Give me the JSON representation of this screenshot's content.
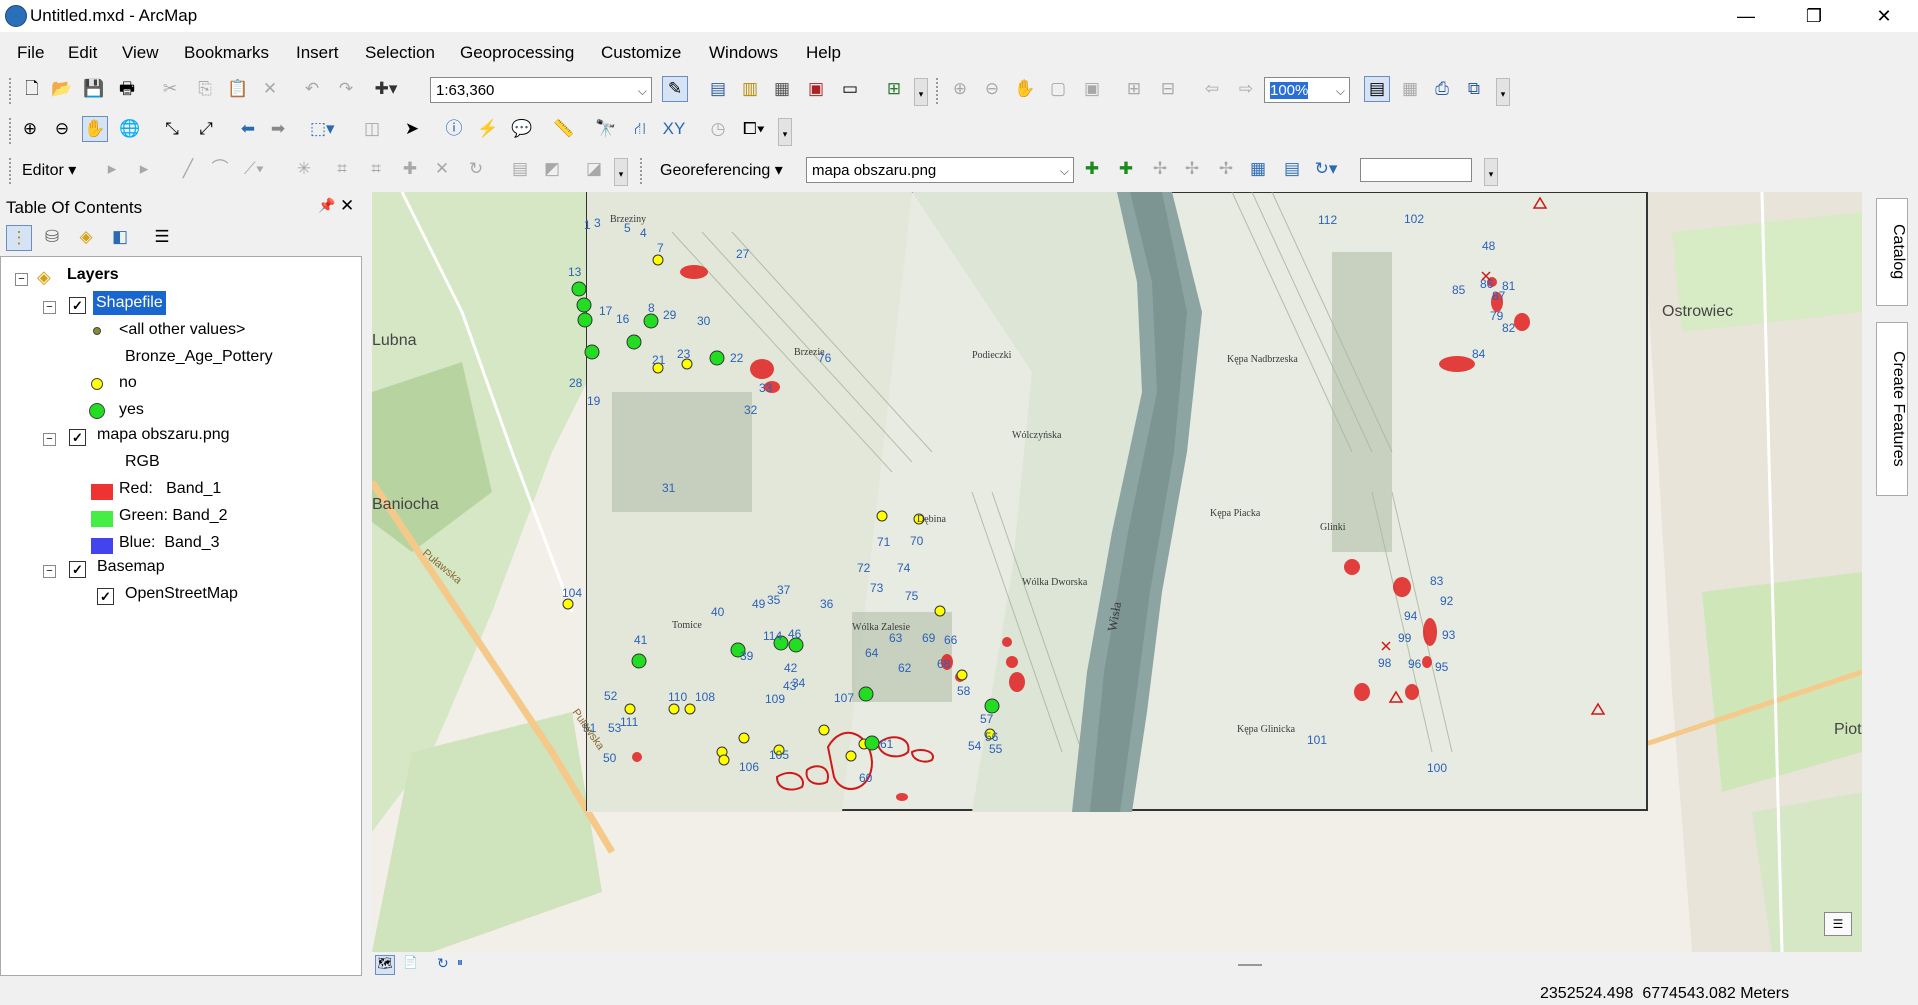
{
  "window": {
    "title": "Untitled.mxd - ArcMap",
    "minimize": "—",
    "maximize": "❐",
    "close": "✕"
  },
  "menu": [
    "File",
    "Edit",
    "View",
    "Bookmarks",
    "Insert",
    "Selection",
    "Geoprocessing",
    "Customize",
    "Windows",
    "Help"
  ],
  "standard_toolbar": {
    "scale_value": "1:63,360",
    "zoom_percent": "100%"
  },
  "editor_toolbar": {
    "editor_label": "Editor ▾"
  },
  "georef_toolbar": {
    "label": "Georeferencing ▾",
    "layer_value": "mapa obszaru.png",
    "input_value": ""
  },
  "toc": {
    "title": "Table Of Contents",
    "pin": "ᵖ",
    "close": "✕",
    "layers_label": "Layers",
    "shapefile": {
      "name": "Shapefile",
      "other": "<all other values>",
      "field": "Bronze_Age_Pottery",
      "no": "no",
      "yes": "yes"
    },
    "raster": {
      "name": "mapa obszaru.png",
      "rgb": "RGB",
      "red": "Red:   Band_1",
      "green": "Green: Band_2",
      "blue": "Blue:  Band_3"
    },
    "basemap": {
      "name": "Basemap",
      "osm": "OpenStreetMap"
    }
  },
  "map": {
    "basemap_labels": [
      "Lubna",
      "Baniocha",
      "Ostrowiec",
      "Piotr",
      "Puławska",
      "Puławska"
    ],
    "hist_labels": [
      "Brzeziny",
      "Brzezie",
      "Wólka Zalesie",
      "Wólka Dworska",
      "Kępa Nadbrzeska",
      "Kępa Glinicka",
      "Tomice",
      "Podieczki",
      "Wólczyńska",
      "Wisła",
      "Kępa Piacka",
      "Glinki",
      "Dębina"
    ],
    "site_numbers": [
      "13",
      "17",
      "16",
      "8",
      "29",
      "30",
      "21",
      "22",
      "23",
      "76",
      "33",
      "32",
      "19",
      "28",
      "27",
      "7",
      "4",
      "5",
      "1",
      "3",
      "31",
      "71",
      "74",
      "73",
      "72",
      "75",
      "70",
      "69",
      "63",
      "66",
      "62",
      "68",
      "58",
      "57",
      "56",
      "55",
      "54",
      "61",
      "64",
      "60",
      "42",
      "43",
      "52",
      "53",
      "51",
      "50",
      "110",
      "111",
      "108",
      "109",
      "105",
      "106",
      "107",
      "104",
      "114",
      "39",
      "40",
      "41",
      "46",
      "49",
      "35",
      "36",
      "37",
      "34",
      "48",
      "81",
      "86",
      "87",
      "82",
      "84",
      "85",
      "79",
      "83",
      "92",
      "93",
      "94",
      "95",
      "96",
      "98",
      "99",
      "100",
      "101",
      "112",
      "102",
      "103"
    ],
    "colors": {
      "yes_marker": "#22dd22",
      "no_marker": "#ffff00",
      "site_polygon": "#e02020"
    }
  },
  "status": {
    "coords": "2352524.498  6774543.082 Meters"
  },
  "right_tabs": {
    "catalog": "Catalog",
    "create_features": "Create Features"
  }
}
